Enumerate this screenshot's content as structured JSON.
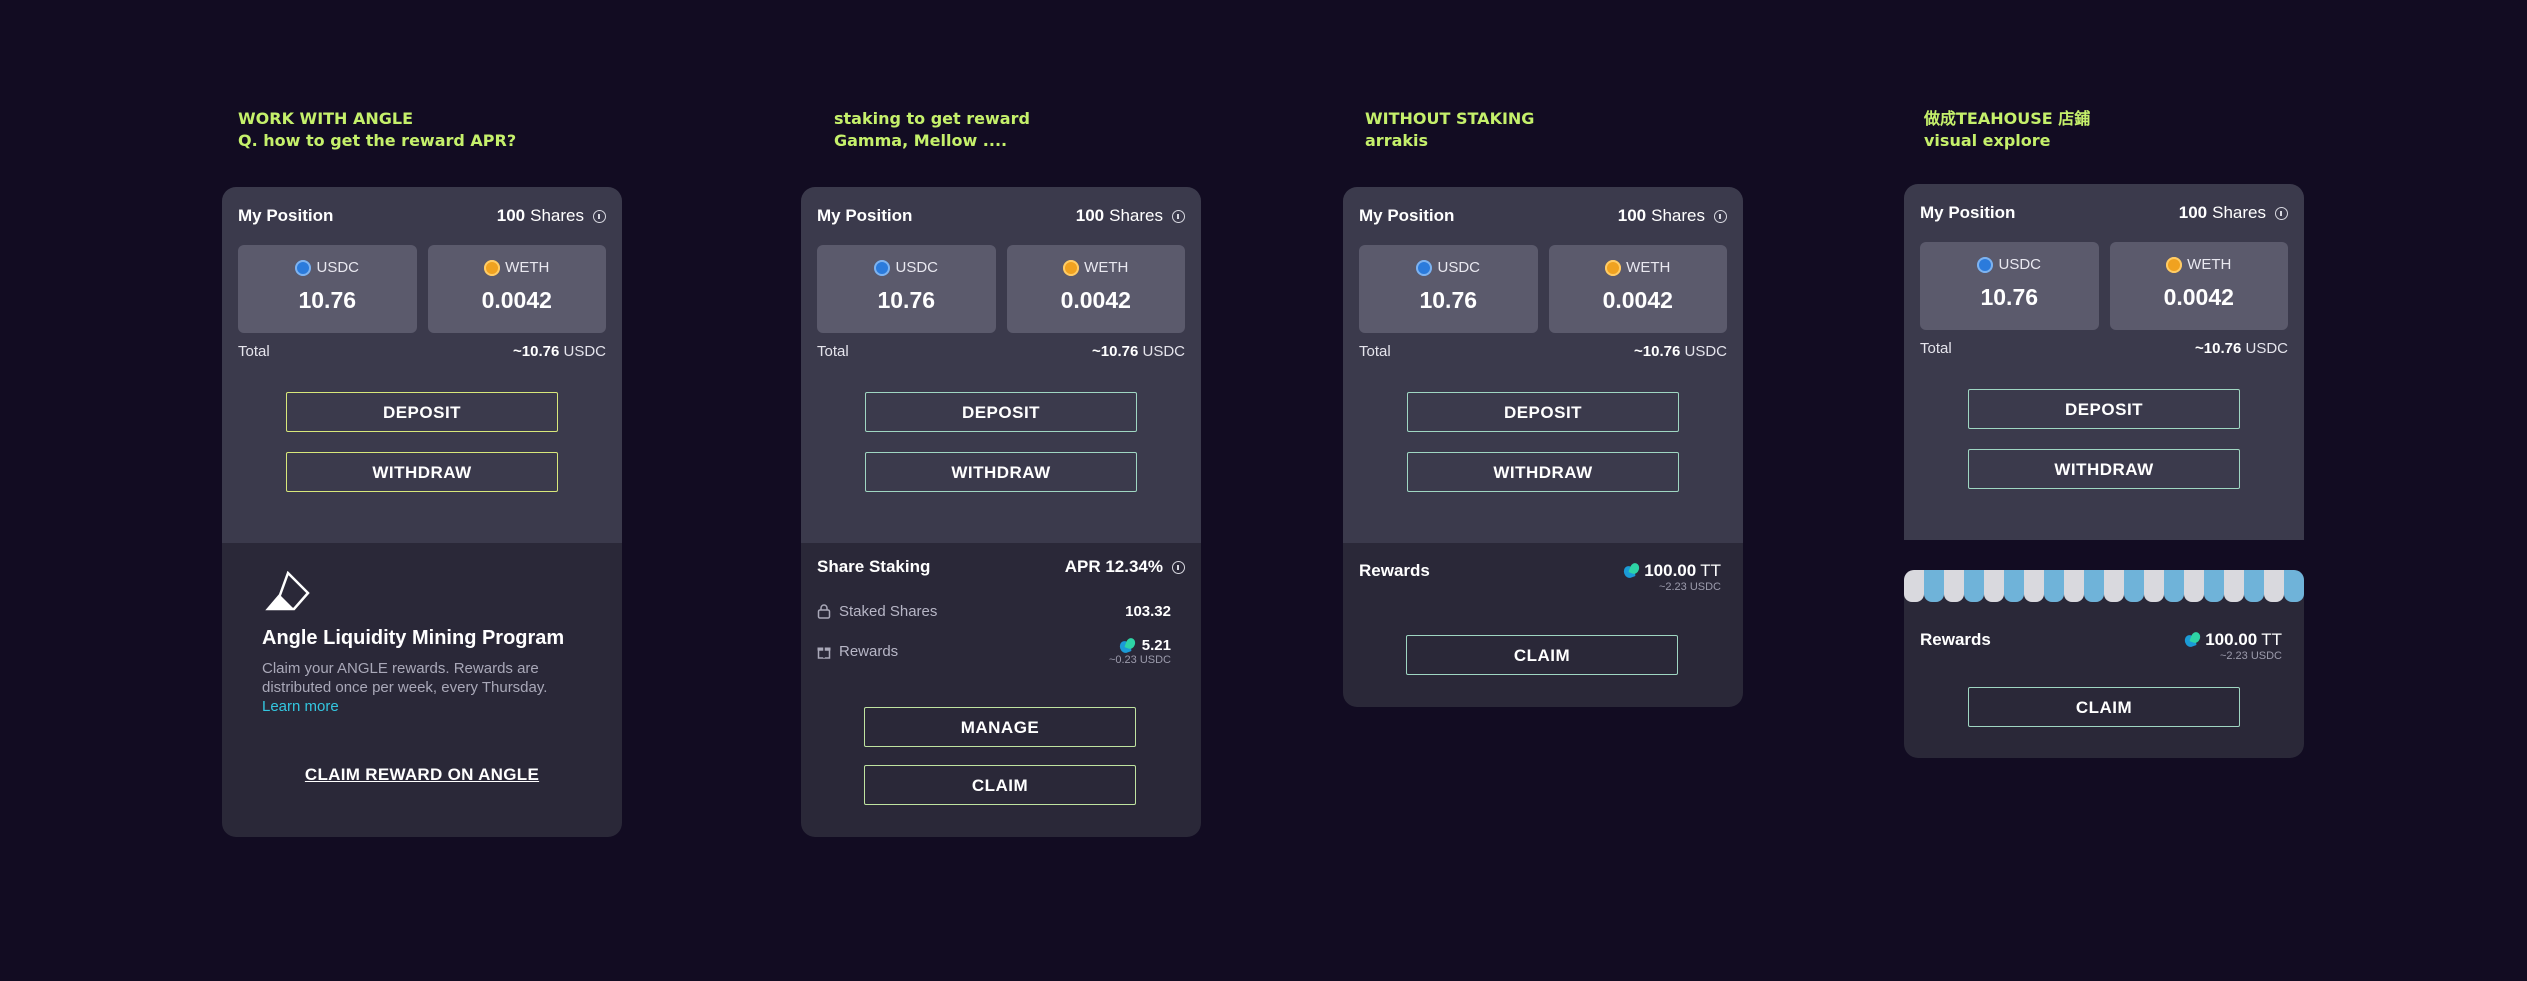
{
  "notes": [
    {
      "line1": "WORK WITH ANGLE",
      "line2": "Q.  how to get the reward APR?"
    },
    {
      "line1": "staking to get reward",
      "line2": "Gamma, Mellow ...."
    },
    {
      "line1": "WITHOUT STAKING",
      "line2": "arrakis"
    },
    {
      "line1": "做成TEAHOUSE 店鋪",
      "line2": "visual explore"
    }
  ],
  "position": {
    "title": "My Position",
    "shares_count": "100",
    "shares_label": "Shares",
    "usdc_label": "USDC",
    "usdc_value": "10.76",
    "weth_label": "WETH",
    "weth_value": "0.0042",
    "total_label": "Total",
    "total_prefix": "~10.76",
    "total_unit": "USDC",
    "deposit_label": "DEPOSIT",
    "withdraw_label": "WITHDRAW"
  },
  "angle": {
    "title": "Angle Liquidity Mining Program",
    "desc": "Claim your ANGLE rewards. Rewards are distributed once per week, every Thursday.",
    "link": "Learn more",
    "claim_label": "CLAIM REWARD ON ANGLE"
  },
  "staking": {
    "title": "Share Staking",
    "apr": "APR 12.34%",
    "staked_label": "Staked Shares",
    "staked_value": "103.32",
    "rewards_label": "Rewards",
    "rewards_value": "5.21",
    "rewards_usd": "~0.23 USDC",
    "manage_label": "MANAGE",
    "claim_label": "CLAIM"
  },
  "rewards": {
    "title": "Rewards",
    "amount": "100.00",
    "unit": "TT",
    "usd": "~2.23 USDC",
    "claim_label": "CLAIM"
  },
  "colors": {
    "background": "#120c22",
    "note": "#c5f06b",
    "card_top": "#3b3a4c",
    "card_bottom": "#2a2838",
    "button_border": "#9fd6c2",
    "link": "#33c6e0"
  },
  "icons": [
    "info-icon",
    "usdc-coin-icon",
    "weth-coin-icon",
    "angle-logo-icon",
    "lock-icon",
    "gift-icon",
    "tt-token-icon"
  ]
}
